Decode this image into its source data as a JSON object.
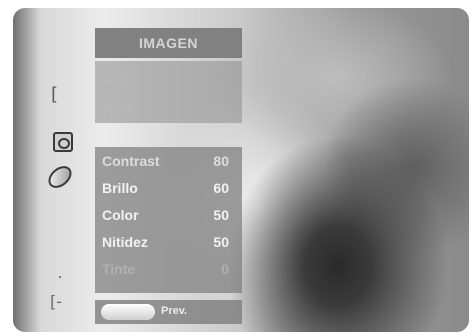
{
  "menu": {
    "title": "IMAGEN",
    "sub_items": [
      "APC",
      "ACC"
    ],
    "settings": [
      {
        "label": "Contrast",
        "value": "80"
      },
      {
        "label": "Brillo",
        "value": "60"
      },
      {
        "label": "Color",
        "value": "50"
      },
      {
        "label": "Nitidez",
        "value": "50"
      },
      {
        "label": "Tinte",
        "value": "0"
      }
    ],
    "footer": {
      "prev_label": "Prev."
    }
  },
  "side_icons": [
    "bracket-icon",
    "picture-square-icon",
    "oval-disc-icon",
    "dot-icon",
    "bracket-arrow-icon"
  ]
}
